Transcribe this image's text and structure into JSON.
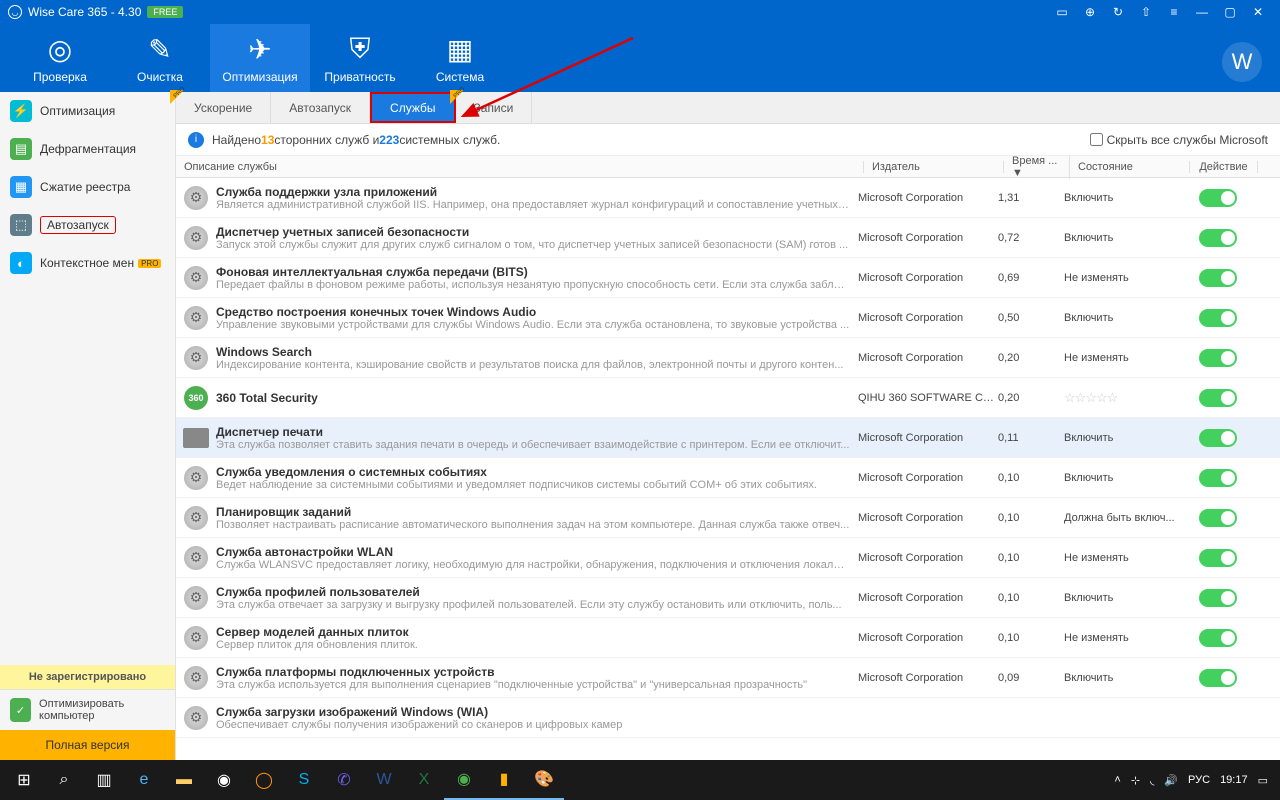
{
  "titlebar": {
    "title": "Wise Care 365 - 4.30",
    "badge": "FREE"
  },
  "topnav": [
    {
      "label": "Проверка",
      "icon": "◎"
    },
    {
      "label": "Очистка",
      "icon": "✎"
    },
    {
      "label": "Оптимизация",
      "icon": "✈",
      "active": true
    },
    {
      "label": "Приватность",
      "icon": "⛨"
    },
    {
      "label": "Система",
      "icon": "▦"
    }
  ],
  "sidebar": {
    "items": [
      {
        "label": "Оптимизация",
        "color": "#00bcd4",
        "glyph": "⚡"
      },
      {
        "label": "Дефрагментация",
        "color": "#4caf50",
        "glyph": "▤"
      },
      {
        "label": "Сжатие реестра",
        "color": "#2196f3",
        "glyph": "▦"
      },
      {
        "label": "Автозапуск",
        "color": "#607d8b",
        "glyph": "⬚",
        "selected": true
      },
      {
        "label": "Контекстное мен",
        "color": "#03a9f4",
        "glyph": "◐",
        "pro": "PRO"
      }
    ],
    "unregistered": "Не зарегистрировано",
    "optimize": "Оптимизировать компьютер",
    "fullversion": "Полная версия"
  },
  "subtabs": [
    {
      "label": "Ускорение",
      "pro": true
    },
    {
      "label": "Автозапуск"
    },
    {
      "label": "Службы",
      "active": true
    },
    {
      "label": "Записи",
      "pro": true
    }
  ],
  "infobar": {
    "prefix": "Найдено ",
    "num1": "13",
    "mid": " сторонних служб и ",
    "num2": "223",
    "suffix": " системных служб.",
    "hide_ms": "Скрыть все службы Microsoft"
  },
  "columns": {
    "desc": "Описание службы",
    "publisher": "Издатель",
    "time": "Время ... ▼",
    "state": "Состояние",
    "action": "Действие"
  },
  "services": [
    {
      "name": "Служба поддержки узла приложений",
      "desc": "Является административной службой IIS. Например, она предоставляет журнал конфигураций и сопоставление учетных д...",
      "pub": "Microsoft Corporation",
      "time": "1,31",
      "state": "Включить"
    },
    {
      "name": "Диспетчер учетных записей безопасности",
      "desc": "Запуск этой службы служит для других служб сигналом о том, что диспетчер учетных записей безопасности (SAM) готов ...",
      "pub": "Microsoft Corporation",
      "time": "0,72",
      "state": "Включить"
    },
    {
      "name": "Фоновая интеллектуальная служба передачи (BITS)",
      "desc": "Передает файлы в фоновом режиме работы, используя незанятую пропускную способность сети. Если эта служба заблок...",
      "pub": "Microsoft Corporation",
      "time": "0,69",
      "state": "Не изменять"
    },
    {
      "name": "Средство построения конечных точек Windows Audio",
      "desc": "Управление звуковыми устройствами для службы Windows Audio.  Если эта служба остановлена, то звуковые устройства ...",
      "pub": "Microsoft Corporation",
      "time": "0,50",
      "state": "Включить"
    },
    {
      "name": "Windows Search",
      "desc": "Индексирование контента, кэширование свойств и результатов поиска для файлов, электронной почты и другого контен...",
      "pub": "Microsoft Corporation",
      "time": "0,20",
      "state": "Не изменять"
    },
    {
      "name": "360 Total Security",
      "desc": "",
      "pub": "QIHU 360 SOFTWARE CO...",
      "time": "0,20",
      "state": "stars",
      "icon": "360"
    },
    {
      "name": "Диспетчер печати",
      "desc": "Эта служба позволяет ставить задания печати в очередь и обеспечивает взаимодействие с принтером. Если ее отключит...",
      "pub": "Microsoft Corporation",
      "time": "0,11",
      "state": "Включить",
      "hl": true,
      "icon": "printer"
    },
    {
      "name": "Служба уведомления о системных событиях",
      "desc": "Ведет наблюдение за системными событиями и уведомляет подписчиков системы событий COM+ об этих событиях.",
      "pub": "Microsoft Corporation",
      "time": "0,10",
      "state": "Включить"
    },
    {
      "name": "Планировщик заданий",
      "desc": "Позволяет настраивать расписание автоматического выполнения задач на этом компьютере.  Данная служба также отвеч...",
      "pub": "Microsoft Corporation",
      "time": "0,10",
      "state": "Должна быть включ..."
    },
    {
      "name": "Служба автонастройки WLAN",
      "desc": "Служба WLANSVC предоставляет логику, необходимую для настройки, обнаружения, подключения и отключения локальн...",
      "pub": "Microsoft Corporation",
      "time": "0,10",
      "state": "Не изменять"
    },
    {
      "name": "Служба профилей пользователей",
      "desc": "Эта служба отвечает за загрузку и выгрузку профилей пользователей. Если эту службу остановить или отключить, поль...",
      "pub": "Microsoft Corporation",
      "time": "0,10",
      "state": "Включить"
    },
    {
      "name": "Сервер моделей данных плиток",
      "desc": "Сервер плиток для обновления плиток.",
      "pub": "Microsoft Corporation",
      "time": "0,10",
      "state": "Не изменять"
    },
    {
      "name": "Служба платформы подключенных устройств",
      "desc": "Эта служба используется для выполнения сценариев \"подключенные устройства\" и \"универсальная прозрачность\"",
      "pub": "Microsoft Corporation",
      "time": "0,09",
      "state": "Включить"
    },
    {
      "name": "Служба загрузки изображений Windows (WIA)",
      "desc": "Обеспечивает службы получения изображений со сканеров и цифровых камер",
      "pub": "",
      "time": "",
      "state": ""
    }
  ],
  "taskbar": {
    "lang": "РУС",
    "clock": "19:17"
  }
}
